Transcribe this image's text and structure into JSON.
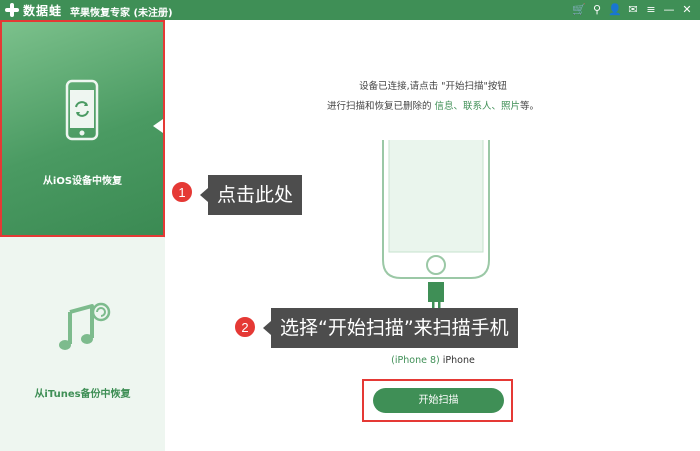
{
  "titlebar": {
    "brand": "数据蛙",
    "title": "苹果恢复专家 (未注册)",
    "icons": [
      "cart-icon",
      "key-icon",
      "user-icon",
      "chat-icon",
      "menu-icon",
      "minimize-icon",
      "close-icon"
    ],
    "icon_glyphs": [
      "🛒",
      "⚲",
      "👤",
      "✉",
      "≡",
      "—",
      "✕"
    ]
  },
  "sidebar": {
    "items": [
      {
        "label": "从iOS设备中恢复",
        "icon": "phone-refresh-icon",
        "active": true
      },
      {
        "label": "从iTunes备份中恢复",
        "icon": "itunes-music-icon",
        "active": false
      }
    ]
  },
  "main": {
    "info_line1": "设备已连接,请点击 \"开始扫描\"按钮",
    "info_line2_prefix": "进行扫描和恢复已删除的 ",
    "info_line2_highlight": "信息、联系人、照片",
    "info_line2_suffix": "等。",
    "device_model": "(iPhone 8)",
    "device_type": " iPhone",
    "start_button": "开始扫描"
  },
  "callouts": [
    {
      "number": "1",
      "text": "点击此处"
    },
    {
      "number": "2",
      "text": "选择“开始扫描”来扫描手机"
    }
  ],
  "colors": {
    "brand_green": "#3f8f56",
    "highlight_red": "#e53935",
    "tooltip_bg": "#4d4d4d"
  }
}
